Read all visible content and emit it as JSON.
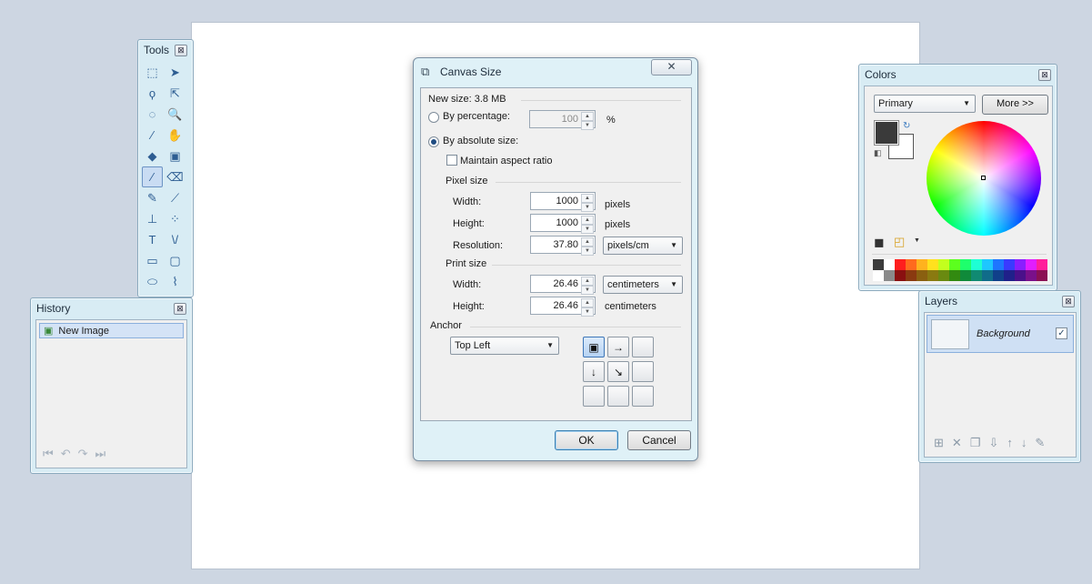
{
  "tools_window": {
    "title": "Tools",
    "close": "⊠",
    "tools": [
      {
        "name": "rectangle-select-icon",
        "glyph": "⬚"
      },
      {
        "name": "move-selected-pixels-icon",
        "glyph": "➤"
      },
      {
        "name": "lasso-select-icon",
        "glyph": "ϙ"
      },
      {
        "name": "move-selection-icon",
        "glyph": "⇱"
      },
      {
        "name": "ellipse-select-icon",
        "glyph": "◌"
      },
      {
        "name": "zoom-icon",
        "glyph": "🔍"
      },
      {
        "name": "magic-wand-icon",
        "glyph": "⁄"
      },
      {
        "name": "pan-hand-icon",
        "glyph": "✋"
      },
      {
        "name": "paint-bucket-icon",
        "glyph": "◆"
      },
      {
        "name": "gradient-icon",
        "glyph": "▣"
      },
      {
        "name": "paintbrush-icon",
        "glyph": "∕"
      },
      {
        "name": "eraser-icon",
        "glyph": "⌫"
      },
      {
        "name": "pencil-icon",
        "glyph": "✎"
      },
      {
        "name": "color-picker-icon",
        "glyph": "⟋"
      },
      {
        "name": "clone-stamp-icon",
        "glyph": "⊥"
      },
      {
        "name": "recolor-icon",
        "glyph": "⁘"
      },
      {
        "name": "text-icon",
        "glyph": "T"
      },
      {
        "name": "line-curve-icon",
        "glyph": "\\/"
      },
      {
        "name": "rectangle-shape-icon",
        "glyph": "▭"
      },
      {
        "name": "rounded-rectangle-icon",
        "glyph": "▢"
      },
      {
        "name": "ellipse-shape-icon",
        "glyph": "⬭"
      },
      {
        "name": "freeform-shape-icon",
        "glyph": "⌇"
      }
    ],
    "active_tool": "paintbrush-icon"
  },
  "history_window": {
    "title": "History",
    "close": "⊠",
    "items": [
      "New Image"
    ],
    "controls": [
      "⏮",
      "↶",
      "↷",
      "⏭"
    ]
  },
  "dialog": {
    "title": "Canvas Size",
    "close": "✕",
    "new_size": "New size: 3.8 MB",
    "by_percentage": "By percentage:",
    "percentage_value": "100",
    "percent_unit": "%",
    "by_absolute": "By absolute size:",
    "maintain_aspect": "Maintain aspect ratio",
    "pixel_size": "Pixel size",
    "width_label": "Width:",
    "height_label": "Height:",
    "resolution_label": "Resolution:",
    "px_width": "1000",
    "px_height": "1000",
    "pixels_unit": "pixels",
    "resolution": "37.80",
    "resolution_unit": "pixels/cm",
    "print_size": "Print size",
    "print_width": "26.46",
    "print_height": "26.46",
    "print_unit_select": "centimeters",
    "print_unit_label": "centimeters",
    "anchor_label": "Anchor",
    "anchor_select": "Top Left",
    "anchor_buttons": [
      "▣",
      "→",
      "",
      "↓",
      "↘",
      "",
      "",
      "",
      ""
    ],
    "ok": "OK",
    "cancel": "Cancel"
  },
  "colors_window": {
    "title": "Colors",
    "close": "⊠",
    "mode_select": "Primary",
    "more_button": "More >>",
    "primary_color": "#3a3a3a",
    "secondary_color": "#ffffff",
    "palette_row1": [
      "#3b3b3b",
      "#ffffff",
      "#ff1e1e",
      "#ff6a1e",
      "#ffb21e",
      "#ffe11e",
      "#c3ff1e",
      "#5cff1e",
      "#1eff6c",
      "#1effd4",
      "#1ec7ff",
      "#1e76ff",
      "#3a3aff",
      "#8a1eff",
      "#e11eff",
      "#ff1e9b"
    ],
    "palette_row2": [
      "#ffffff",
      "#8a8a8a",
      "#8a1010",
      "#8a3a10",
      "#8a6010",
      "#8a7a10",
      "#6a8a10",
      "#328a10",
      "#108a3a",
      "#108a72",
      "#106c8a",
      "#10408a",
      "#20208a",
      "#4a108a",
      "#7a108a",
      "#8a1054"
    ]
  },
  "layers_window": {
    "title": "Layers",
    "close": "⊠",
    "layers": [
      {
        "name": "Background",
        "visible": "✓"
      }
    ],
    "controls": [
      "⊞",
      "✕",
      "❐",
      "⇩",
      "↑",
      "↓",
      "✎"
    ]
  }
}
